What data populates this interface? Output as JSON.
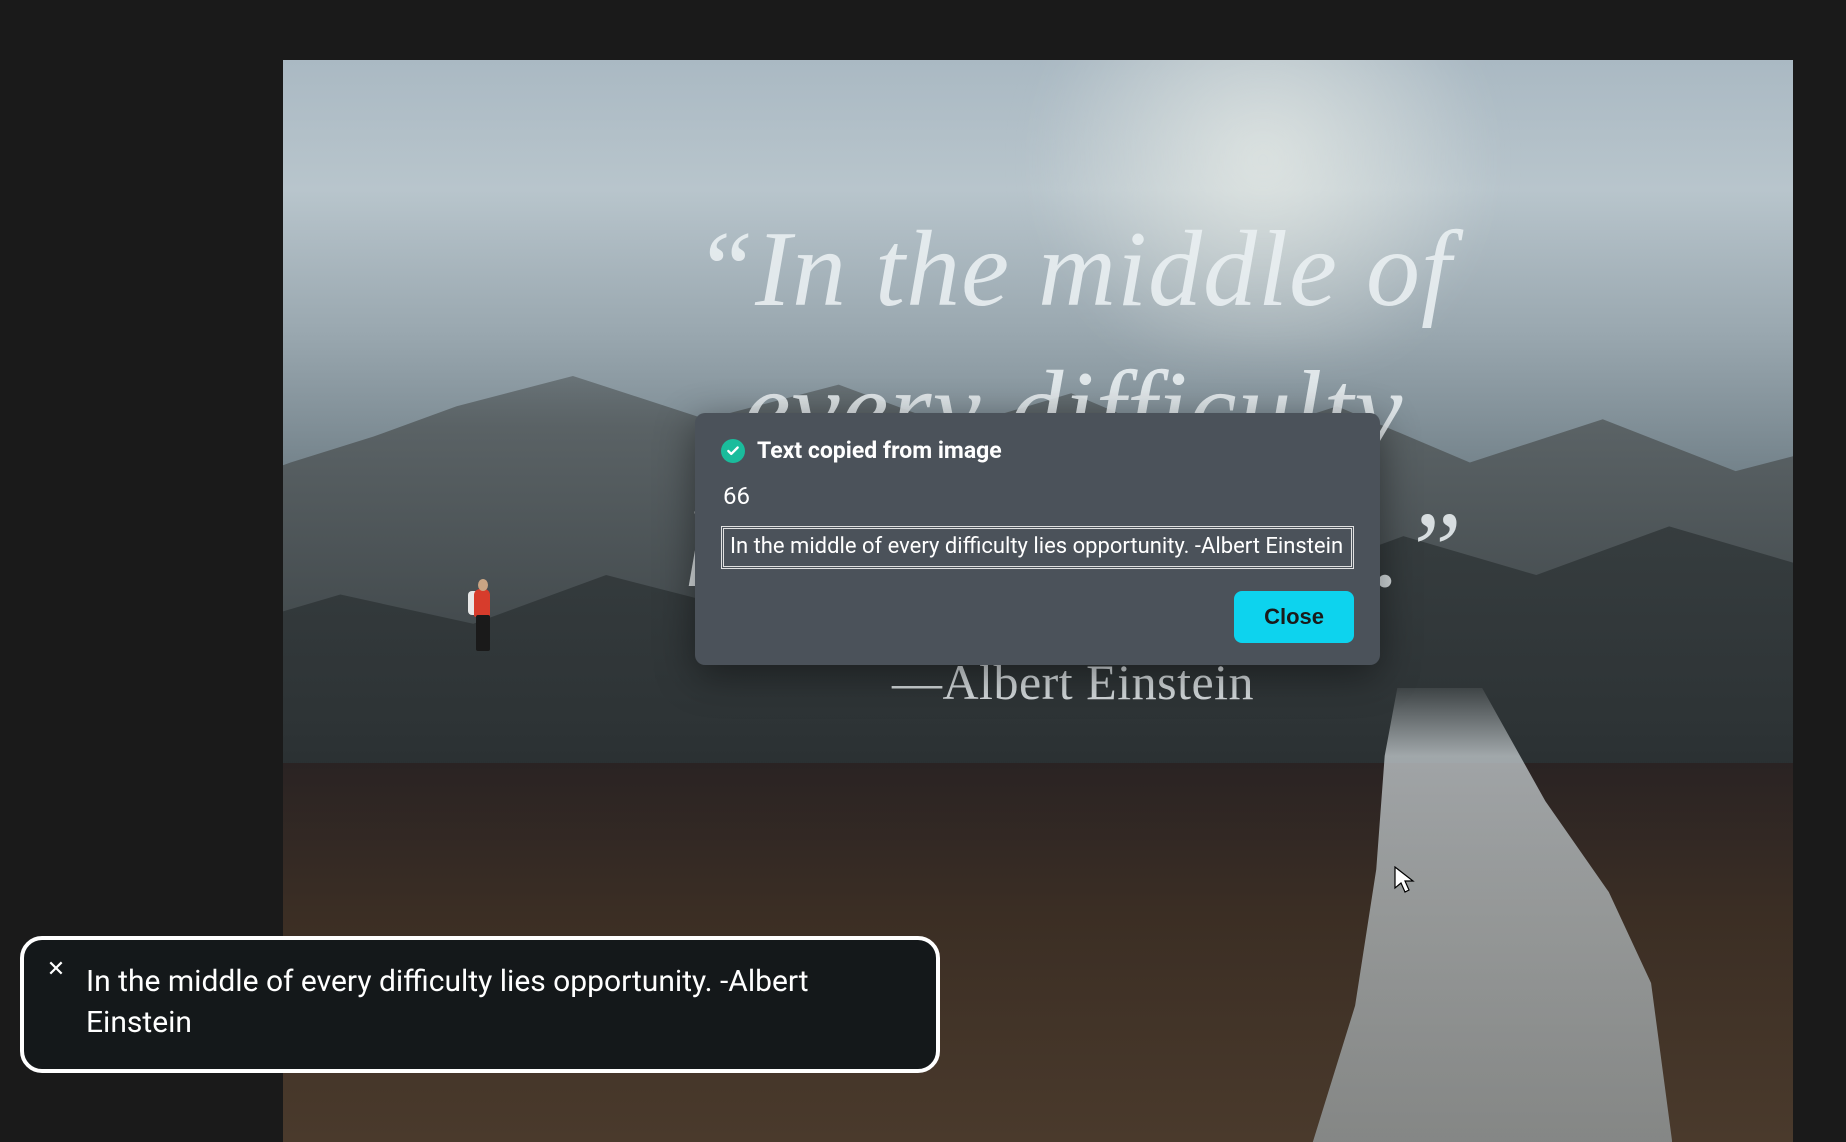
{
  "image": {
    "quote_line1": "“In the middle of",
    "quote_line2": "every difficulty",
    "quote_line3": "lies opportunity.”",
    "attribution": "—Albert Einstein"
  },
  "modal": {
    "title": "Text copied from image",
    "check_icon": "check-icon",
    "line1": "66",
    "extracted_text": "In the middle of every difficulty lies opportunity. -Albert Einstein",
    "close_label": "Close",
    "accent_color": "#1abc9c",
    "button_color": "#0dd3ee"
  },
  "toast": {
    "text": "In the middle of every difficulty lies opportunity. -Albert Einstein",
    "close_icon": "close-icon"
  }
}
